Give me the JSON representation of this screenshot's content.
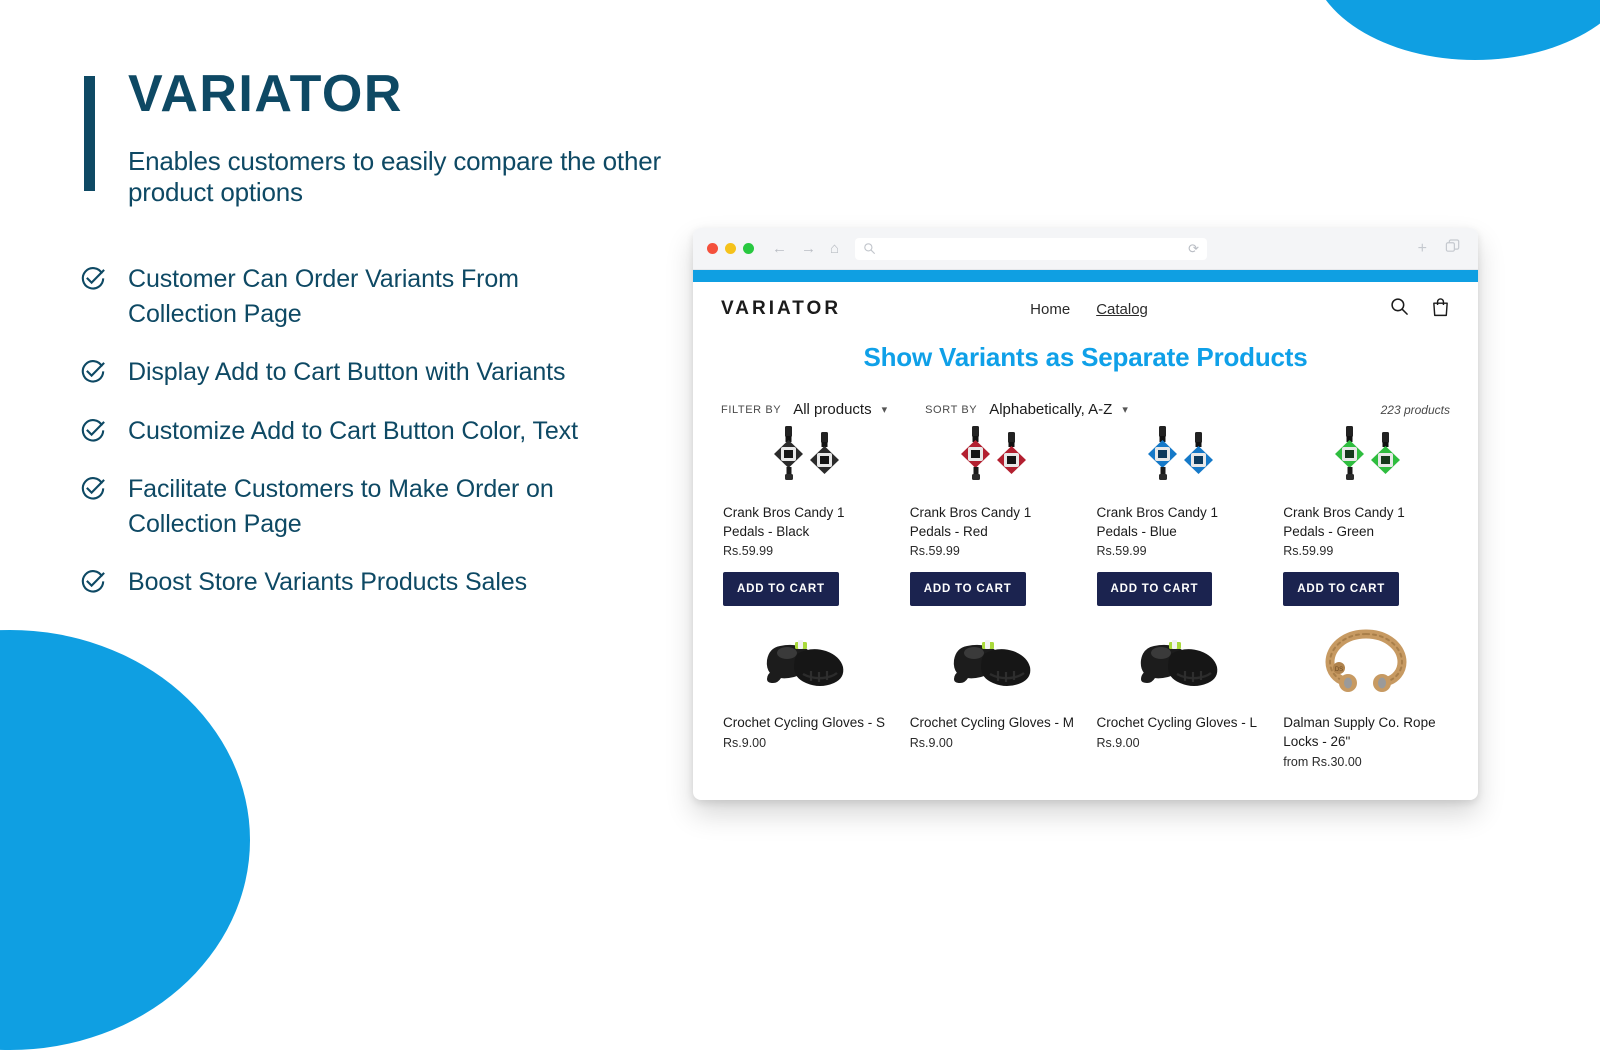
{
  "theme": {
    "navy": "#0E4964",
    "bright_blue": "#0F9FE2",
    "heading_blue": "#0FA0E8",
    "button_navy": "#1B234F"
  },
  "hero": {
    "title": "VARIATOR",
    "subtitle": "Enables customers to easily compare the other product options"
  },
  "features": [
    {
      "icon": "check-circle-icon",
      "text": "Customer Can Order Variants From Collection Page"
    },
    {
      "icon": "check-circle-icon",
      "text": "Display Add to Cart Button with Variants"
    },
    {
      "icon": "check-circle-icon",
      "text": "Customize Add to Cart Button Color, Text"
    },
    {
      "icon": "check-circle-icon",
      "text": "Facilitate  Customers to Make Order on Collection Page"
    },
    {
      "icon": "check-circle-icon",
      "text": "Boost Store Variants Products Sales"
    }
  ],
  "browser": {
    "traffic_lights": [
      "close",
      "minimize",
      "maximize"
    ],
    "back_icon": "arrow-left-icon",
    "forward_icon": "arrow-right-icon",
    "home_icon": "home-icon",
    "address_placeholder": "",
    "address_value": "",
    "search_icon": "search-icon",
    "reload_icon": "reload-icon",
    "new_tab_icon": "plus-icon",
    "tabs_icon": "copy-tabs-icon"
  },
  "store": {
    "logo": "VARIATOR",
    "nav": [
      {
        "label": "Home",
        "active": false
      },
      {
        "label": "Catalog",
        "active": true
      }
    ],
    "search_icon": "search-icon",
    "cart_icon": "shopping-bag-icon",
    "page_heading": "Show Variants as Separate Products",
    "filter": {
      "filter_label": "FILTER BY",
      "filter_value": "All products",
      "sort_label": "SORT BY",
      "sort_value": "Alphabetically, A-Z",
      "product_count": "223 products"
    },
    "products_row1": [
      {
        "name": "Crank Bros Candy 1 Pedals - Black",
        "price": "Rs.59.99",
        "cta": "ADD TO CART",
        "image": "bike-pedal-black",
        "color": "#2b2b2b"
      },
      {
        "name": "Crank Bros Candy 1 Pedals - Red",
        "price": "Rs.59.99",
        "cta": "ADD TO CART",
        "image": "bike-pedal-red",
        "color": "#b32030"
      },
      {
        "name": "Crank Bros Candy 1 Pedals - Blue",
        "price": "Rs.59.99",
        "cta": "ADD TO CART",
        "image": "bike-pedal-blue",
        "color": "#1579c8"
      },
      {
        "name": "Crank Bros Candy 1 Pedals - Green",
        "price": "Rs.59.99",
        "cta": "ADD TO CART",
        "image": "bike-pedal-green",
        "color": "#2fbd3f"
      }
    ],
    "products_row2": [
      {
        "name": "Crochet Cycling Gloves - S",
        "price": "Rs.9.00",
        "image": "cycling-gloves"
      },
      {
        "name": "Crochet Cycling Gloves - M",
        "price": "Rs.9.00",
        "image": "cycling-gloves"
      },
      {
        "name": "Crochet Cycling Gloves - L",
        "price": "Rs.9.00",
        "image": "cycling-gloves"
      },
      {
        "name": "Dalman Supply Co. Rope Locks - 26\"",
        "price": "from Rs.30.00",
        "image": "rope-lock"
      }
    ]
  }
}
